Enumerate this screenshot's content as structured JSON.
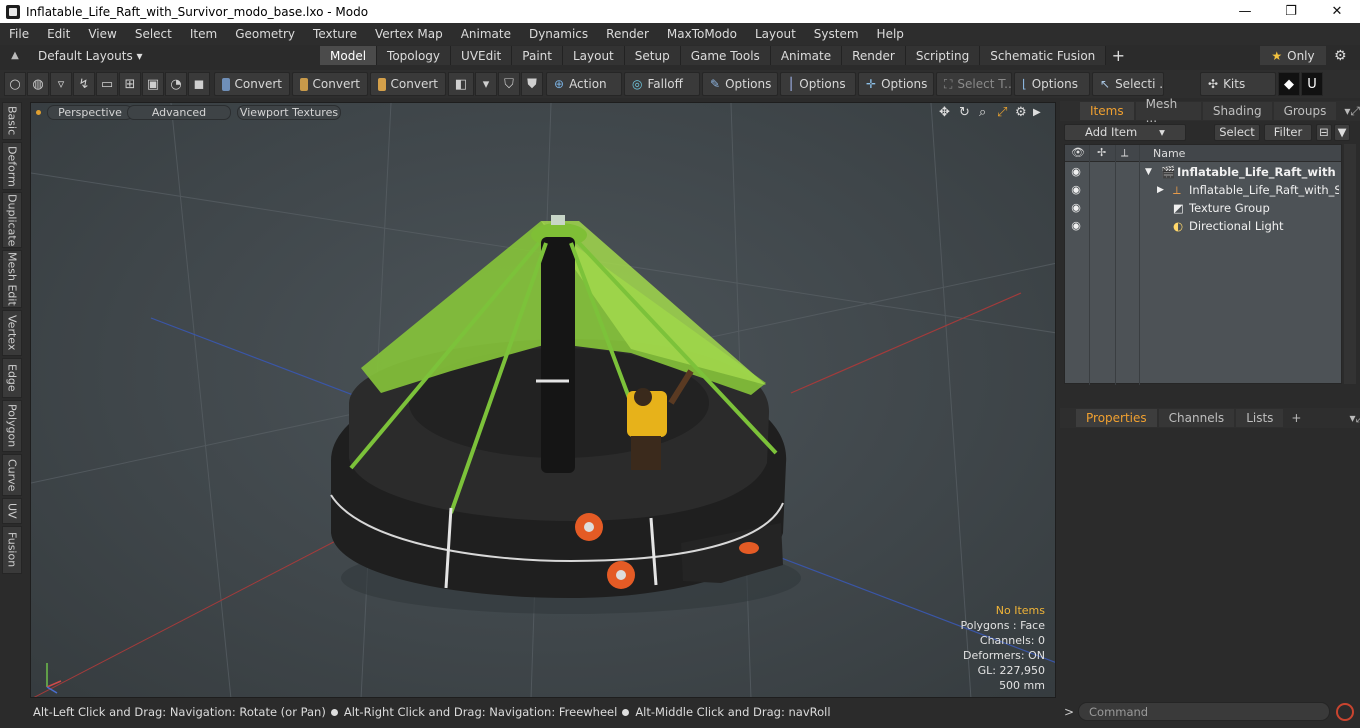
{
  "window": {
    "title": "Inflatable_Life_Raft_with_Survivor_modo_base.lxo - Modo",
    "minimize": "—",
    "maximize": "❐",
    "close": "✕"
  },
  "menu": [
    "File",
    "Edit",
    "View",
    "Select",
    "Item",
    "Geometry",
    "Texture",
    "Vertex Map",
    "Animate",
    "Dynamics",
    "Render",
    "MaxToModo",
    "Layout",
    "System",
    "Help"
  ],
  "layouts": {
    "dropdown": "Default Layouts ▾",
    "tabs": [
      "Model",
      "Topology",
      "UVEdit",
      "Paint",
      "Layout",
      "Setup",
      "Game Tools",
      "Animate",
      "Render",
      "Scripting",
      "Schematic Fusion"
    ],
    "active_tab": "Model",
    "only_label": "Only"
  },
  "toolbar": {
    "convert1": "Convert",
    "convert2": "Convert",
    "convert3": "Convert",
    "action": "Action",
    "falloff": "Falloff",
    "options1": "Options",
    "options2": "Options",
    "options3": "Options",
    "select_t": "Select T...",
    "options4": "Options",
    "selecti": "Selecti ...",
    "kits": "Kits"
  },
  "left_tabs": [
    "Basic",
    "Deform",
    "Duplicate",
    "Mesh Edit",
    "Vertex",
    "Edge",
    "Polygon",
    "Curve",
    "UV",
    "Fusion"
  ],
  "viewport": {
    "perspective": "Perspective",
    "advanced": "Advanced",
    "textures": "Viewport Textures",
    "stats": {
      "no_items": "No Items",
      "polygons": "Polygons : Face",
      "channels": "Channels: 0",
      "deformers": "Deformers: ON",
      "gl": "GL: 227,950",
      "size": "500 mm"
    }
  },
  "status": {
    "part1": "Alt-Left Click and Drag: Navigation: Rotate (or Pan)",
    "part2": "Alt-Right Click and Drag: Navigation: Freewheel",
    "part3": "Alt-Middle Click and Drag: navRoll"
  },
  "items_panel": {
    "tabs": [
      "Items",
      "Mesh ...",
      "Shading",
      "Groups"
    ],
    "active_tab": "Items",
    "add_item": "Add Item",
    "select": "Select",
    "filter": "Filter",
    "name_header": "Name",
    "rows": [
      {
        "label": "Inflatable_Life_Raft_with ...",
        "bold": true
      },
      {
        "label": "Inflatable_Life_Raft_with_S ..."
      },
      {
        "label": "Texture Group"
      },
      {
        "label": "Directional Light"
      }
    ]
  },
  "properties_panel": {
    "tabs": [
      "Properties",
      "Channels",
      "Lists"
    ],
    "active_tab": "Properties",
    "plus": "+"
  },
  "command": {
    "prompt": ">",
    "placeholder": "Command"
  }
}
